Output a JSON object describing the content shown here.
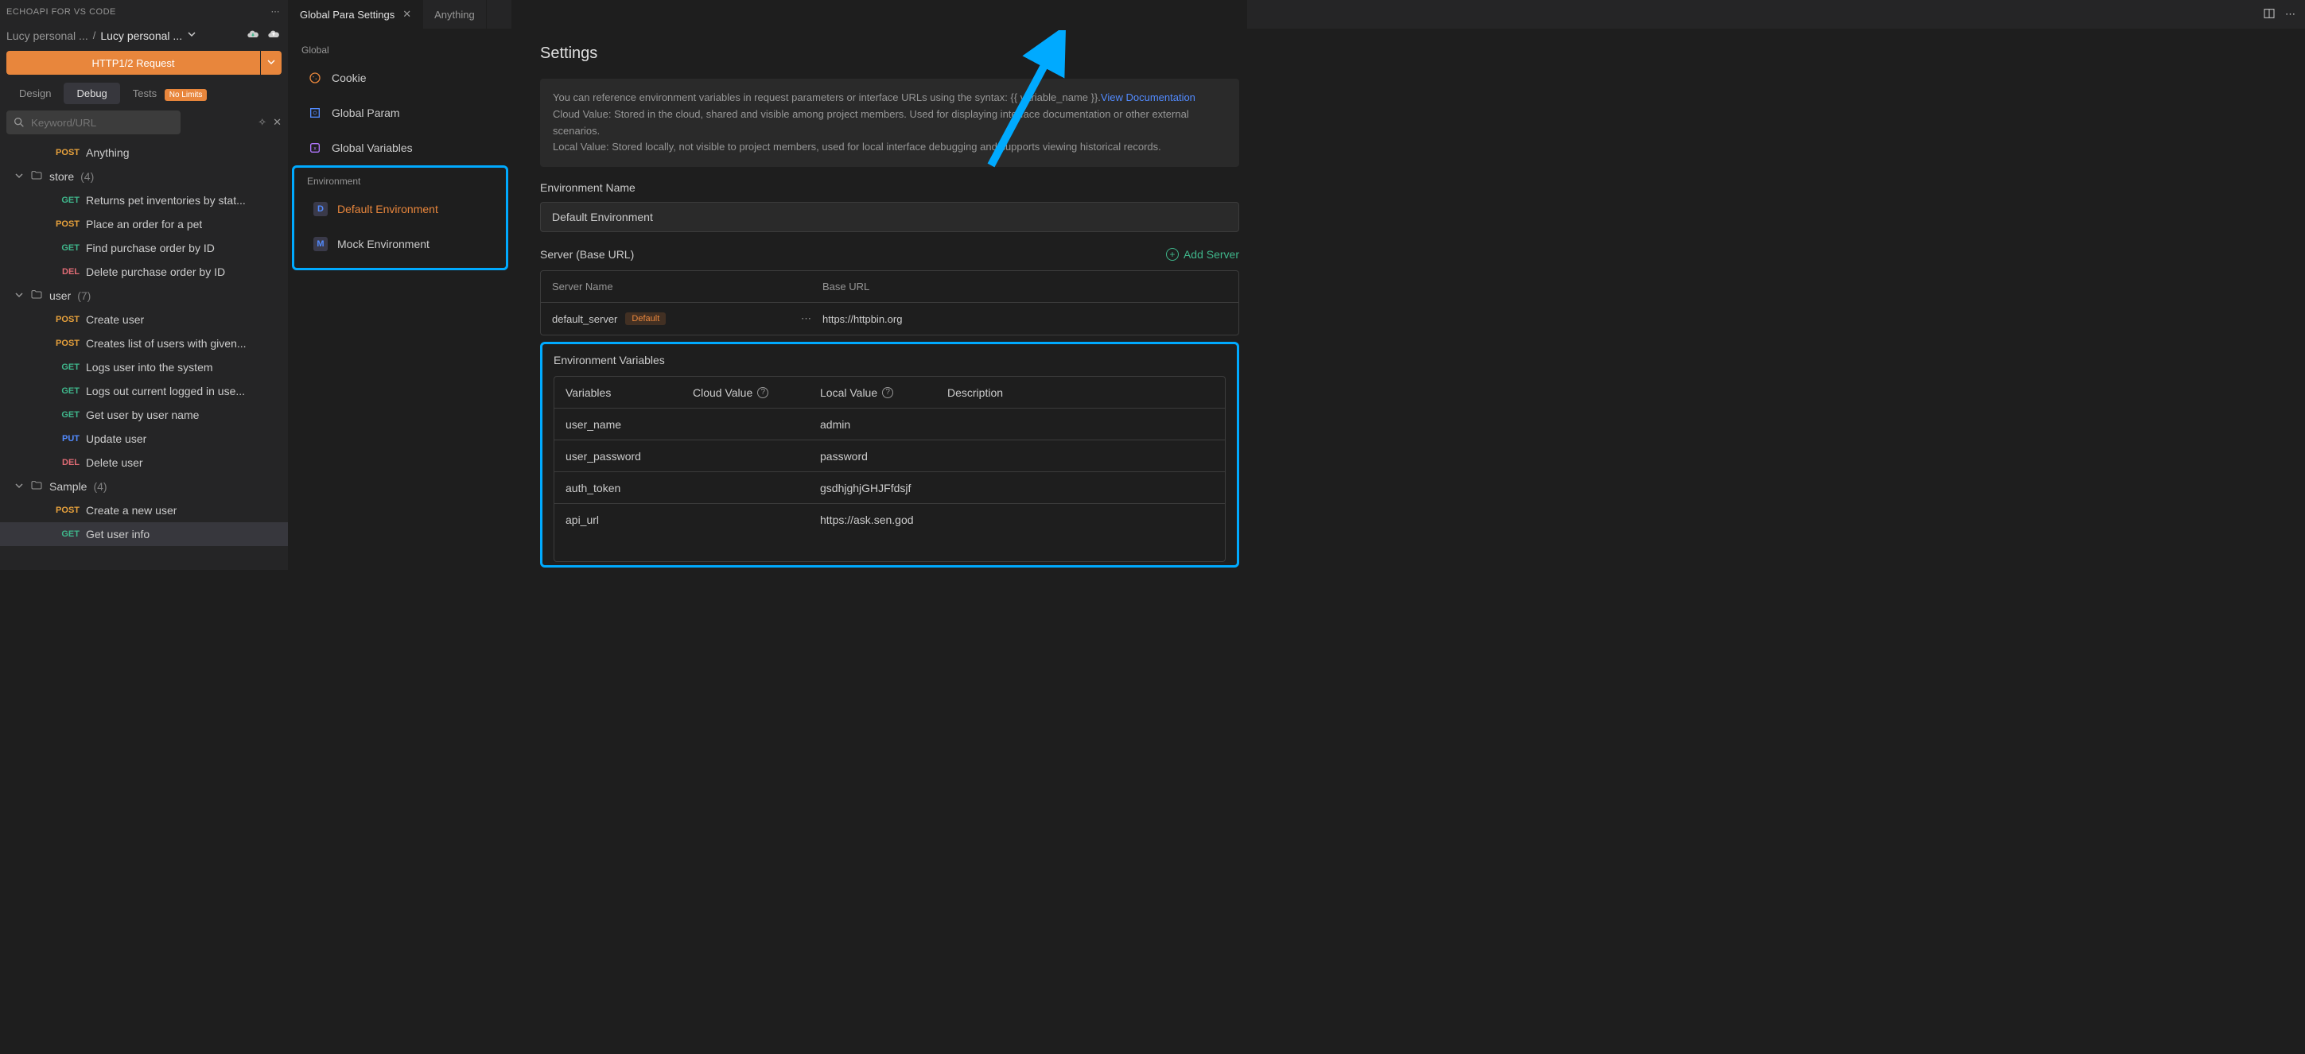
{
  "left": {
    "title": "ECHOAPI FOR VS CODE",
    "breadcrumb": {
      "a": "Lucy personal ...",
      "b": "Lucy personal ..."
    },
    "primary_button": "HTTP1/2 Request",
    "tabs": {
      "design": "Design",
      "debug": "Debug",
      "tests": "Tests",
      "tests_badge": "No Limits"
    },
    "search_placeholder": "Keyword/URL",
    "tree": [
      {
        "type": "item",
        "method": "POST",
        "label": "Anything"
      },
      {
        "type": "folder",
        "label": "store",
        "count": "(4)"
      },
      {
        "type": "item",
        "method": "GET",
        "label": "Returns pet inventories by stat..."
      },
      {
        "type": "item",
        "method": "POST",
        "label": "Place an order for a pet"
      },
      {
        "type": "item",
        "method": "GET",
        "label": "Find purchase order by ID"
      },
      {
        "type": "item",
        "method": "DEL",
        "label": "Delete purchase order by ID"
      },
      {
        "type": "folder",
        "label": "user",
        "count": "(7)"
      },
      {
        "type": "item",
        "method": "POST",
        "label": "Create user"
      },
      {
        "type": "item",
        "method": "POST",
        "label": "Creates list of users with given..."
      },
      {
        "type": "item",
        "method": "GET",
        "label": "Logs user into the system"
      },
      {
        "type": "item",
        "method": "GET",
        "label": "Logs out current logged in use..."
      },
      {
        "type": "item",
        "method": "GET",
        "label": "Get user by user name"
      },
      {
        "type": "item",
        "method": "PUT",
        "label": "Update user"
      },
      {
        "type": "item",
        "method": "DEL",
        "label": "Delete user"
      },
      {
        "type": "folder",
        "label": "Sample",
        "count": "(4)"
      },
      {
        "type": "item",
        "method": "POST",
        "label": "Create a new user"
      },
      {
        "type": "item",
        "method": "GET",
        "label": "Get user info",
        "selected": true
      }
    ]
  },
  "top_tabs": [
    {
      "label": "Global Para Settings",
      "active": true
    },
    {
      "label": "Anything",
      "active": false
    }
  ],
  "mid": {
    "global_title": "Global",
    "items": [
      {
        "label": "Cookie",
        "icon": "cookie-icon",
        "color": "#e8863c"
      },
      {
        "label": "Global Param",
        "icon": "param-icon",
        "color": "#528bff"
      },
      {
        "label": "Global Variables",
        "icon": "var-icon",
        "color": "#b277ff"
      }
    ],
    "env_title": "Environment",
    "envs": [
      {
        "letter": "D",
        "label": "Default Environment",
        "active": true
      },
      {
        "letter": "M",
        "label": "Mock Environment",
        "active": false
      }
    ]
  },
  "main": {
    "title": "Settings",
    "banner": {
      "line1": "You can reference environment variables in request parameters or interface URLs using the syntax: {{ variable_name }}.",
      "link": "View Documentation",
      "line2": "Cloud Value: Stored in the cloud, shared and visible among project members. Used for displaying interface documentation or other external scenarios.",
      "line3": "Local Value: Stored locally, not visible to project members, used for local interface debugging and supports viewing historical records."
    },
    "env_name_label": "Environment Name",
    "env_name_value": "Default Environment",
    "server_label": "Server (Base URL)",
    "add_server": "Add Server",
    "server_table": {
      "head_a": "Server Name",
      "head_b": "Base URL",
      "row_name": "default_server",
      "row_tag": "Default",
      "row_url": "https://httpbin.org"
    },
    "env_vars_label": "Environment Variables",
    "vars_head": {
      "a": "Variables",
      "b": "Cloud Value",
      "c": "Local Value",
      "d": "Description"
    },
    "vars_rows": [
      {
        "name": "user_name",
        "cloud": "",
        "local": "admin",
        "desc": ""
      },
      {
        "name": "user_password",
        "cloud": "",
        "local": "password",
        "desc": ""
      },
      {
        "name": "auth_token",
        "cloud": "",
        "local": "gsdhjghjGHJFfdsjf",
        "desc": ""
      },
      {
        "name": "api_url",
        "cloud": "",
        "local": "https://ask.sen.god",
        "desc": ""
      }
    ]
  }
}
